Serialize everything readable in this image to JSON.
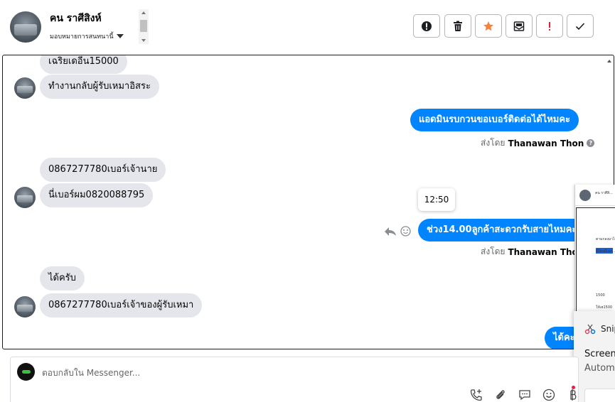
{
  "header": {
    "contact_name": "คน ราศีสิงห์",
    "assign_label": "มอบหมายการสนทนานี้"
  },
  "toolbar": {
    "buttons": [
      {
        "name": "spam-button",
        "icon": "alert-circle-icon"
      },
      {
        "name": "delete-button",
        "icon": "trash-icon"
      },
      {
        "name": "star-button",
        "icon": "star-icon",
        "color": "#f5833d"
      },
      {
        "name": "mark-unread-button",
        "icon": "mail-icon"
      },
      {
        "name": "follow-up-button",
        "icon": "exclamation-icon",
        "color": "#e41e3f"
      },
      {
        "name": "done-button",
        "icon": "check-icon"
      }
    ]
  },
  "messages": {
    "m1": "เฉริยเดอีน15000",
    "m2": "ทำงานกลับผู้รับเหมาอิสระ",
    "m3": "แอดมินรบกวนขอเบอร์ติดต่อได้ไหมคะ",
    "m4": "0867277780เบอร์เจ้านาย",
    "m5": "นี่เบอร์ผม0820088795",
    "m6": "ช่วง14.00ลูกค้าสะดวกรับสายไหมคะ",
    "m7": "ได้ครับ",
    "m8": "0867277780เบอร์เจ้าของผู้รับเหมา",
    "m9": "ได้คะ"
  },
  "sent_by": {
    "prefix": "ส่งโดย",
    "agent": "Thanawan Thon"
  },
  "tooltip_time": "12:50",
  "overlay": {
    "thumb_name": "คน ราศีสิ...",
    "thumb_line1": "ตามกลงมาได้",
    "thumb_line2": "มีใครมีเลงเ...",
    "thumb_num1": "1500",
    "thumb_num2": "ให้เฮ1500"
  },
  "snip": {
    "app_name": "Snip",
    "title": "Screens",
    "subtitle": "Automa"
  },
  "composer": {
    "placeholder": "ตอบกลับใน Messenger..."
  },
  "colors": {
    "outgoing_bubble": "#0084ff",
    "incoming_bubble": "#e4e6eb",
    "star": "#f5833d",
    "alert": "#e41e3f"
  }
}
